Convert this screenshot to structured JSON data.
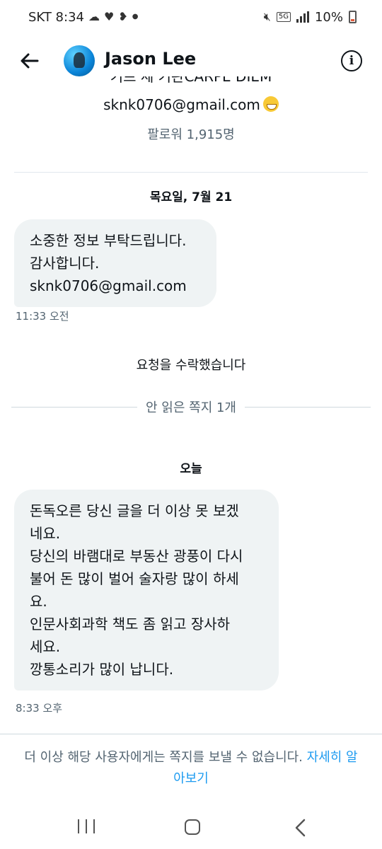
{
  "status_bar": {
    "carrier_time": "SKT 8:34",
    "notification_icons": [
      "cloud-icon",
      "heart-icon",
      "chat-bubble-icon",
      "dot-icon"
    ],
    "network_tag": "5G",
    "battery": "10%"
  },
  "header": {
    "name": "Jason Lee",
    "back_icon": "arrow-left-icon",
    "info_icon": "info-circle-icon"
  },
  "profile": {
    "bio_cut": "기프 세 기관CARPE DIEM",
    "email": "sknk0706@gmail.com",
    "followers": "팔로워 1,915명"
  },
  "conversation": {
    "date_1": "목요일, 7월 21",
    "message_1": "소중한 정보 부탁드립니다.\n감사합니다.\nsknk0706@gmail.com",
    "time_1": "11:33 오전",
    "system_note": "요청을 수락했습니다",
    "unread_label": "안 읽은 쪽지 1개",
    "date_2": "오늘",
    "message_2": "돈독오른 당신 글을 더 이상 못 보겠\n네요.\n당신의 바램대로 부동산 광풍이 다시\n불어 돈 많이 벌어 술자랑 많이 하세\n요.\n인문사회과학 책도 좀  읽고 장사하\n세요.\n깡통소리가 많이 납니다.",
    "time_2": "8:33 오후"
  },
  "footer": {
    "notice": "더 이상 해당 사용자에게는 쪽지를 보낼 수 없습니다. ",
    "link": "자세히 알아보기"
  },
  "colors": {
    "link": "#1d9bf0",
    "bubble": "#eff3f4",
    "muted_text": "#536471"
  }
}
